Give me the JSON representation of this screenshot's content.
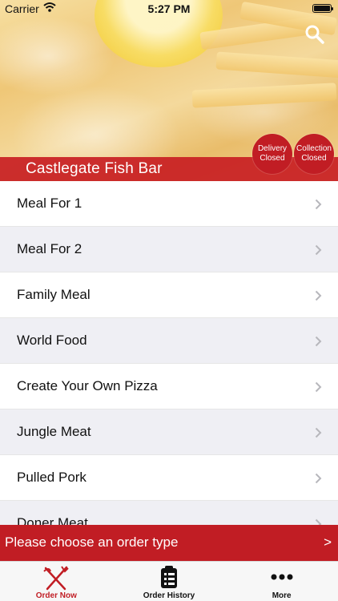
{
  "status_bar": {
    "carrier": "Carrier",
    "time": "5:27 PM"
  },
  "header": {
    "restaurant_name": "Castlegate Fish Bar",
    "delivery_badge": {
      "line1": "Delivery",
      "line2": "Closed"
    },
    "collection_badge": {
      "line1": "Collection",
      "line2": "Closed"
    }
  },
  "menu": {
    "items": [
      {
        "label": "Meal For 1"
      },
      {
        "label": "Meal For 2"
      },
      {
        "label": "Family Meal"
      },
      {
        "label": "World Food"
      },
      {
        "label": "Create Your Own Pizza"
      },
      {
        "label": "Jungle Meat"
      },
      {
        "label": "Pulled Pork"
      },
      {
        "label": "Doner Meat"
      }
    ]
  },
  "order_bar": {
    "text": "Please choose an order type",
    "arrow": ">"
  },
  "tabs": [
    {
      "label": "Order Now",
      "icon": "fork-knife-icon",
      "active": true
    },
    {
      "label": "Order History",
      "icon": "clipboard-icon",
      "active": false
    },
    {
      "label": "More",
      "icon": "more-dots-icon",
      "active": false
    }
  ],
  "colors": {
    "accent": "#c11d24",
    "alt_row": "#efeff4"
  }
}
